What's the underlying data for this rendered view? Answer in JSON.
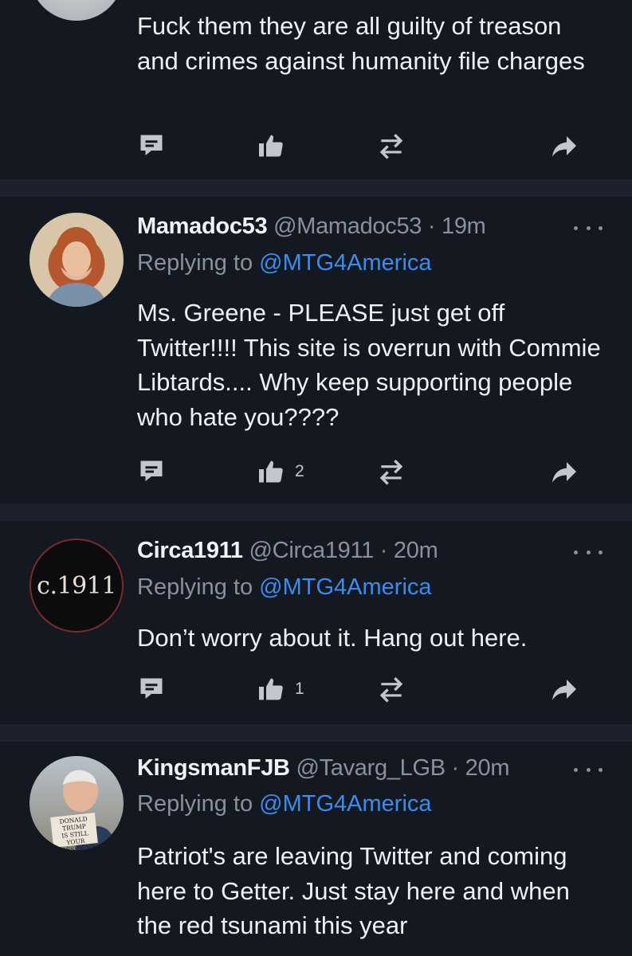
{
  "colors": {
    "background": "#141821",
    "divider": "#1c212b",
    "muted": "#8a919c",
    "mention": "#3b8cf0",
    "text": "#eef0f3"
  },
  "posts": [
    {
      "body": "Fuck them they are all guilty of treason and crimes against humanity file charges",
      "actions": {
        "comment_icon": "comment-icon",
        "like_icon": "thumbs-up-icon",
        "like_count": "",
        "repost_icon": "repost-icon",
        "share_icon": "share-arrow-icon"
      }
    },
    {
      "display_name": "Mamadoc53",
      "handle": "@Mamadoc53",
      "separator": "·",
      "time": "19m",
      "replying_prefix": "Replying to",
      "replying_to": "@MTG4America",
      "body": "Ms. Greene - PLEASE just get off Twitter!!!!  This site is overrun with Commie Libtards....  Why keep supporting people who hate you????",
      "actions": {
        "like_count": "2"
      }
    },
    {
      "display_name": "Circa1911",
      "handle": "@Circa1911",
      "separator": "·",
      "time": "20m",
      "avatar_text": "c.1911",
      "replying_prefix": "Replying to",
      "replying_to": "@MTG4America",
      "body": "Don’t worry about it. Hang out here.",
      "actions": {
        "like_count": "1"
      }
    },
    {
      "display_name": "KingsmanFJB",
      "handle": "@Tavarg_LGB",
      "separator": "·",
      "time": "20m",
      "avatar_sign": [
        "DONALD TRUMP",
        "IS STILL YOUR",
        "PRESIDENT"
      ],
      "replying_prefix": "Replying to",
      "replying_to": "@MTG4America",
      "body": "Patriot's are leaving Twitter and coming here to Getter. Just stay here and when the red tsunami this year"
    }
  ]
}
